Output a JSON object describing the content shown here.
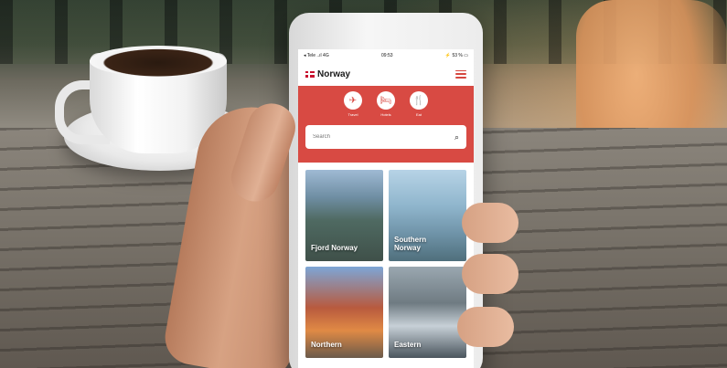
{
  "status_bar": {
    "left": "◂ Tele ..ıl 4G",
    "time": "09:53",
    "right": "⚡ 53 % ▭"
  },
  "app_bar": {
    "brand": "Norway"
  },
  "categories": [
    {
      "label": "Travel",
      "icon": "airplane-icon",
      "glyph": "✈"
    },
    {
      "label": "Hotels",
      "icon": "bed-icon",
      "glyph": "🛏"
    },
    {
      "label": "Eat",
      "icon": "utensils-icon",
      "glyph": "🍴"
    }
  ],
  "search": {
    "placeholder": "Search",
    "icon": "search-icon"
  },
  "tiles": [
    {
      "label": "Fjord Norway"
    },
    {
      "label": "Southern Norway"
    },
    {
      "label": "Northern"
    },
    {
      "label": "Eastern"
    }
  ],
  "colors": {
    "accent": "#d84a43",
    "brand_red": "#c8102e"
  }
}
